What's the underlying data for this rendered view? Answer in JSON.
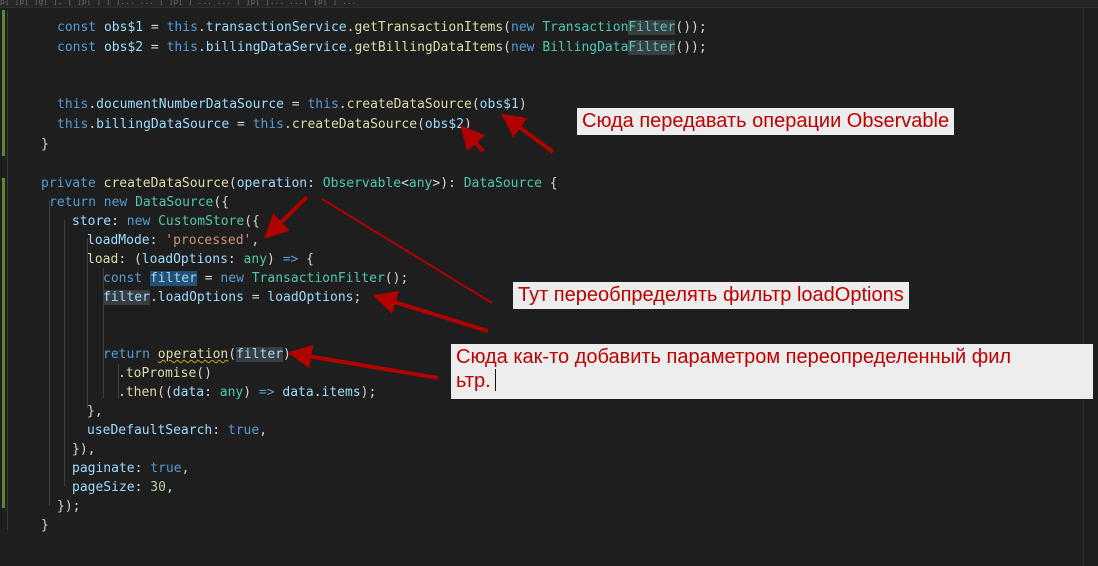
{
  "editor": {
    "colors": {
      "background": "#1e1e1e",
      "keyword": "#569cd6",
      "property": "#9cdcfe",
      "function": "#dcdcaa",
      "type": "#4ec9b0",
      "string": "#ce9178",
      "number": "#b5cea8",
      "plain": "#d4d4d4"
    },
    "top_strip_text": "p[ ]p[ ]g[ ],  [ ]p[ ]  [ ]...  ...  [ ]p[ ]  ...  ...  [ ]p[ ]...  ...[ ]p[ ]  ...",
    "lines": [
      {
        "tokens": [
          [
            "const ",
            "k"
          ],
          [
            "obs$1",
            "v"
          ],
          [
            " = ",
            "p"
          ],
          [
            "this",
            "k"
          ],
          [
            ".",
            "p"
          ],
          [
            "transactionService",
            "v"
          ],
          [
            ".",
            "p"
          ],
          [
            "getTransactionItems",
            "f"
          ],
          [
            "(",
            "p"
          ],
          [
            "new ",
            "k"
          ],
          [
            "Transaction",
            "t"
          ],
          [
            "Filter",
            "th"
          ],
          [
            "());",
            "p"
          ]
        ]
      },
      {
        "tokens": [
          [
            "const ",
            "k"
          ],
          [
            "obs$2",
            "v"
          ],
          [
            " = ",
            "p"
          ],
          [
            "this",
            "k"
          ],
          [
            ".",
            "p"
          ],
          [
            "billingDataService",
            "v"
          ],
          [
            ".",
            "p"
          ],
          [
            "getBillingDataItems",
            "f"
          ],
          [
            "(",
            "p"
          ],
          [
            "new ",
            "k"
          ],
          [
            "BillingData",
            "t"
          ],
          [
            "Filter",
            "th"
          ],
          [
            "());",
            "p"
          ]
        ]
      },
      {
        "tokens": []
      },
      {
        "tokens": []
      },
      {
        "tokens": [
          [
            "this",
            "k"
          ],
          [
            ".",
            "p"
          ],
          [
            "documentNumberDataSource",
            "v"
          ],
          [
            " = ",
            "p"
          ],
          [
            "this",
            "k"
          ],
          [
            ".",
            "p"
          ],
          [
            "createDataSource",
            "f"
          ],
          [
            "(",
            "p"
          ],
          [
            "obs$1",
            "v"
          ],
          [
            ")",
            "p"
          ]
        ]
      },
      {
        "tokens": [
          [
            "this",
            "k"
          ],
          [
            ".",
            "p"
          ],
          [
            "billingDataSource",
            "v"
          ],
          [
            " = ",
            "p"
          ],
          [
            "this",
            "k"
          ],
          [
            ".",
            "p"
          ],
          [
            "createDataSource",
            "f"
          ],
          [
            "(",
            "p"
          ],
          [
            "obs$2",
            "v"
          ],
          [
            ")",
            "p"
          ]
        ]
      },
      {
        "tokens": [
          [
            "}",
            "p"
          ]
        ]
      },
      {
        "tokens": []
      },
      {
        "tokens": [
          [
            "private ",
            "k"
          ],
          [
            "createDataSource",
            "f"
          ],
          [
            "(",
            "p"
          ],
          [
            "operation",
            "v"
          ],
          [
            ": ",
            "p"
          ],
          [
            "Observable",
            "t"
          ],
          [
            "<",
            "p"
          ],
          [
            "any",
            "t"
          ],
          [
            ">): ",
            "p"
          ],
          [
            "DataSource",
            "t"
          ],
          [
            " {",
            "p"
          ]
        ]
      },
      {
        "tokens": [
          [
            "return ",
            "k"
          ],
          [
            "new ",
            "k"
          ],
          [
            "DataSource",
            "t"
          ],
          [
            "({",
            "p"
          ]
        ]
      },
      {
        "tokens": [
          [
            "store",
            "v"
          ],
          [
            ": ",
            "p"
          ],
          [
            "new ",
            "k"
          ],
          [
            "CustomStore",
            "t"
          ],
          [
            "({",
            "p"
          ]
        ]
      },
      {
        "tokens": [
          [
            "loadMode",
            "v"
          ],
          [
            ": ",
            "p"
          ],
          [
            "'processed'",
            "s"
          ],
          [
            ",",
            "p"
          ]
        ]
      },
      {
        "tokens": [
          [
            "load",
            "f"
          ],
          [
            ": (",
            "p"
          ],
          [
            "loadOptions",
            "v"
          ],
          [
            ": ",
            "p"
          ],
          [
            "any",
            "t"
          ],
          [
            ") ",
            "p"
          ],
          [
            "=>",
            "k"
          ],
          [
            " {",
            "p"
          ]
        ]
      },
      {
        "tokens": [
          [
            "const ",
            "k"
          ],
          [
            "filter",
            "vs"
          ],
          [
            " = ",
            "p"
          ],
          [
            "new ",
            "k"
          ],
          [
            "TransactionFilter",
            "t"
          ],
          [
            "();",
            "p"
          ]
        ]
      },
      {
        "tokens": [
          [
            "filter",
            "vh"
          ],
          [
            ".",
            "p"
          ],
          [
            "loadOptions",
            "v"
          ],
          [
            " = ",
            "p"
          ],
          [
            "loadOptions",
            "v"
          ],
          [
            ";",
            "p"
          ]
        ]
      },
      {
        "tokens": []
      },
      {
        "tokens": []
      },
      {
        "tokens": [
          [
            "return ",
            "k"
          ],
          [
            "operation",
            "fw"
          ],
          [
            "(",
            "p"
          ],
          [
            "filter",
            "vh"
          ],
          [
            ")",
            "p"
          ]
        ]
      },
      {
        "tokens": [
          [
            ".",
            "p"
          ],
          [
            "toPromise",
            "f"
          ],
          [
            "()",
            "p"
          ]
        ]
      },
      {
        "tokens": [
          [
            ".",
            "p"
          ],
          [
            "then",
            "f"
          ],
          [
            "((",
            "p"
          ],
          [
            "data",
            "v"
          ],
          [
            ": ",
            "p"
          ],
          [
            "any",
            "t"
          ],
          [
            ") ",
            "p"
          ],
          [
            "=>",
            "k"
          ],
          [
            " ",
            "p"
          ],
          [
            "data",
            "v"
          ],
          [
            ".",
            "p"
          ],
          [
            "items",
            "v"
          ],
          [
            ");",
            "p"
          ]
        ]
      },
      {
        "tokens": [
          [
            "},",
            "p"
          ]
        ]
      },
      {
        "tokens": [
          [
            "useDefaultSearch",
            "v"
          ],
          [
            ": ",
            "p"
          ],
          [
            "true",
            "k"
          ],
          [
            ",",
            "p"
          ]
        ]
      },
      {
        "tokens": [
          [
            "}),",
            "p"
          ]
        ]
      },
      {
        "tokens": [
          [
            "paginate",
            "v"
          ],
          [
            ": ",
            "p"
          ],
          [
            "true",
            "k"
          ],
          [
            ",",
            "p"
          ]
        ]
      },
      {
        "tokens": [
          [
            "pageSize",
            "v"
          ],
          [
            ": ",
            "p"
          ],
          [
            "30",
            "n"
          ],
          [
            ",",
            "p"
          ]
        ]
      },
      {
        "tokens": [
          [
            "});",
            "p"
          ]
        ]
      },
      {
        "tokens": [
          [
            "}",
            "p"
          ]
        ]
      }
    ]
  },
  "annotations": {
    "note_observable": "Сюда передавать операции Observable",
    "note_filter": "Тут переобпределять фильтр loadOptions",
    "note_param": "Сюда как-то добавить параметром переопределенный фил\nьтр.",
    "text_color": "#c00000",
    "box_color": "#ededed",
    "arrow_color": "#b00000"
  }
}
